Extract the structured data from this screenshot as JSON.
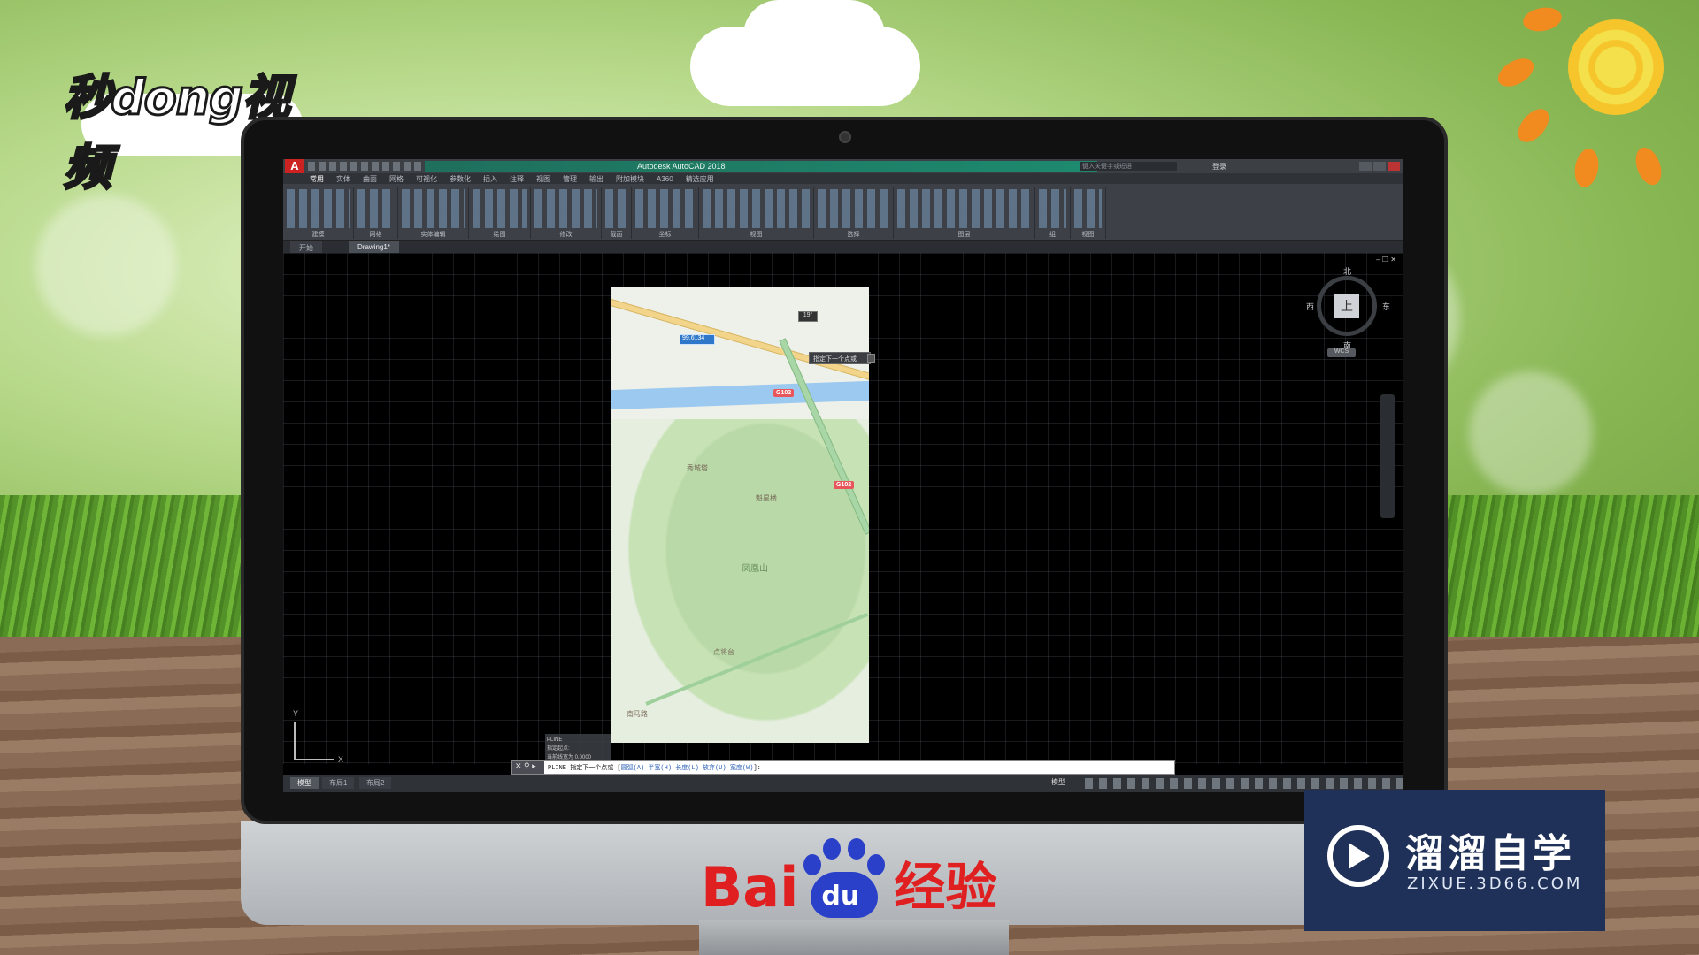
{
  "brand_top": "秒dong视频",
  "autocad": {
    "title": "Autodesk AutoCAD 2018",
    "search_placeholder": "键入关键字或短语",
    "login": "登录",
    "menu": [
      "常用",
      "实体",
      "曲面",
      "网格",
      "可视化",
      "参数化",
      "插入",
      "注释",
      "视图",
      "管理",
      "输出",
      "附加模块",
      "A360",
      "精选应用"
    ],
    "menu_active_index": 0,
    "ribbon_groups": [
      "建模",
      "网格",
      "实体编辑",
      "绘图",
      "修改",
      "截面",
      "坐标",
      "视图",
      "选择",
      "图层",
      "组",
      "视图"
    ],
    "file_tabs": [
      "开始",
      "Drawing1*"
    ],
    "active_file_tab": 1,
    "map": {
      "shields": [
        "G102",
        "G102"
      ],
      "pois": [
        "秀城塔",
        "魁星楼",
        "凤凰山",
        "点将台",
        "南马路"
      ]
    },
    "dynamic_input": "99.6134",
    "angle": "19°",
    "tooltip": "指定下一个点或",
    "viewcube": {
      "top": "上",
      "north": "北",
      "south": "南",
      "east": "东",
      "west": "西",
      "wcs": "WCS"
    },
    "ucs": {
      "x": "X",
      "y": "Y"
    },
    "cmd_history": [
      "PLINE",
      "指定起点:",
      "当前线宽为 0.0000"
    ],
    "command_line": {
      "prefix": "PLINE 指定下一个点或 [",
      "options": "圆弧(A) 半宽(H) 长度(L) 放弃(U) 宽度(W)",
      "suffix": "]:"
    },
    "layout_tabs": [
      "模型",
      "布局1",
      "布局2"
    ],
    "status_model": "模型"
  },
  "baidu": {
    "prefix": "Bai",
    "paw": "du",
    "suffix": "经验"
  },
  "zixue": {
    "name": "溜溜自学",
    "url": "ZIXUE.3D66.COM"
  },
  "colors": {
    "accent_red": "#e02020",
    "baidu_blue": "#2a40c8",
    "zixue_bg": "#1f3158",
    "title_green": "#1d8a6e"
  }
}
